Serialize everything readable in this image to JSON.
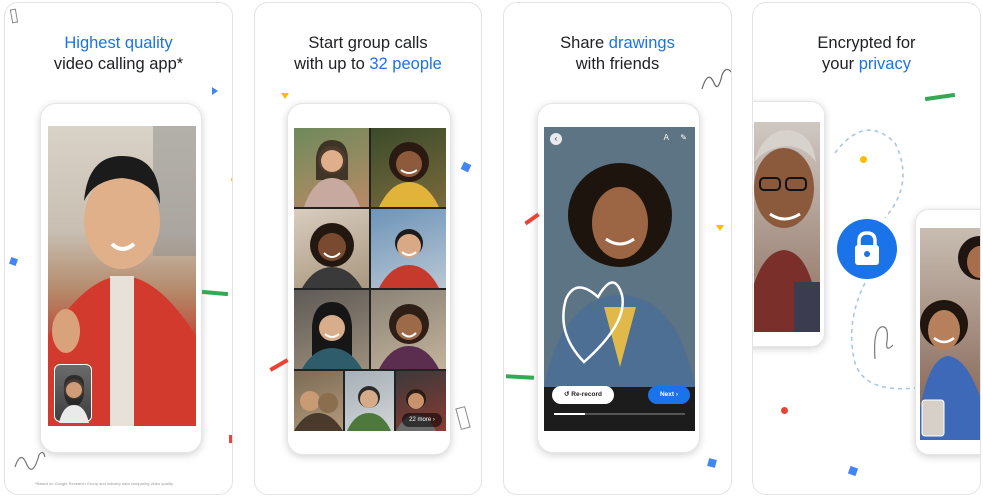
{
  "panels": [
    {
      "title_line1_accent": "Highest quality",
      "title_line2": "video calling app*",
      "footnote": "*Based on Google Research Group and industry data comparing video quality"
    },
    {
      "title_line1": "Start group calls",
      "title_line2_prefix": "with up to ",
      "title_line2_accent": "32 people",
      "more_label": "22 more"
    },
    {
      "title_line1_prefix": "Share ",
      "title_line1_accent": "drawings",
      "title_line2": "with friends",
      "rerecord_label": "Re-record",
      "next_label": "Next"
    },
    {
      "title_line1": "Encrypted for",
      "title_line2_prefix": "your ",
      "title_line2_accent": "privacy"
    }
  ],
  "colors": {
    "accent": "#1a73e8",
    "red": "#ea4335",
    "yellow": "#fbbc04",
    "green": "#34a853",
    "blue": "#4285f4"
  },
  "icons": [
    "lock-icon",
    "back-icon",
    "text-tool-icon",
    "draw-tool-icon",
    "rerecord-icon",
    "chevron-right-icon"
  ]
}
